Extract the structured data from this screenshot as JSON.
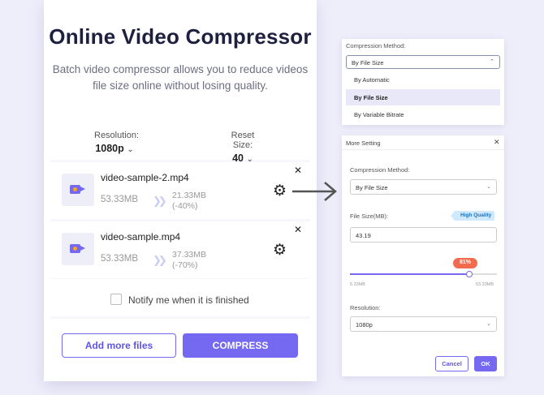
{
  "main": {
    "title": "Online Video Compressor",
    "subtitle": "Batch video compressor allows you to reduce videos file size online without losing quality.",
    "resolution_label": "Resolution:",
    "resolution_value": "1080p",
    "reset_size_label": "Reset Size:",
    "reset_size_value": "40",
    "files": [
      {
        "name": "video-sample-2.mp4",
        "original_size": "53.33MB",
        "new_size": "21.33MB",
        "reduction": "(-40%)"
      },
      {
        "name": "video-sample.mp4",
        "original_size": "53.33MB",
        "new_size": "37.33MB",
        "reduction": "(-70%)"
      }
    ],
    "notify_label": "Notify me when it is finished",
    "add_files_label": "Add more files",
    "compress_label": "COMPRESS"
  },
  "dropdown": {
    "label": "Compression Method:",
    "selected": "By File Size",
    "options": [
      "By Automatic",
      "By File Size",
      "By Variable Bitrate"
    ],
    "selected_index": 1
  },
  "dialog": {
    "title": "More Setting",
    "method_label": "Compression Method:",
    "method_value": "By File Size",
    "file_size_label": "File Size(MB):",
    "quality_badge": "High Quality",
    "file_size_value": "43.19",
    "slider_percent": "81%",
    "slider_fraction": 0.81,
    "slider_min": "5.33MB",
    "slider_max": "53.33MB",
    "resolution_label": "Resolution:",
    "resolution_value": "1080p",
    "cancel_label": "Cancel",
    "ok_label": "OK"
  },
  "colors": {
    "accent": "#7469f0",
    "badge": "#cfeaff",
    "bubble": "#f26b4f"
  }
}
